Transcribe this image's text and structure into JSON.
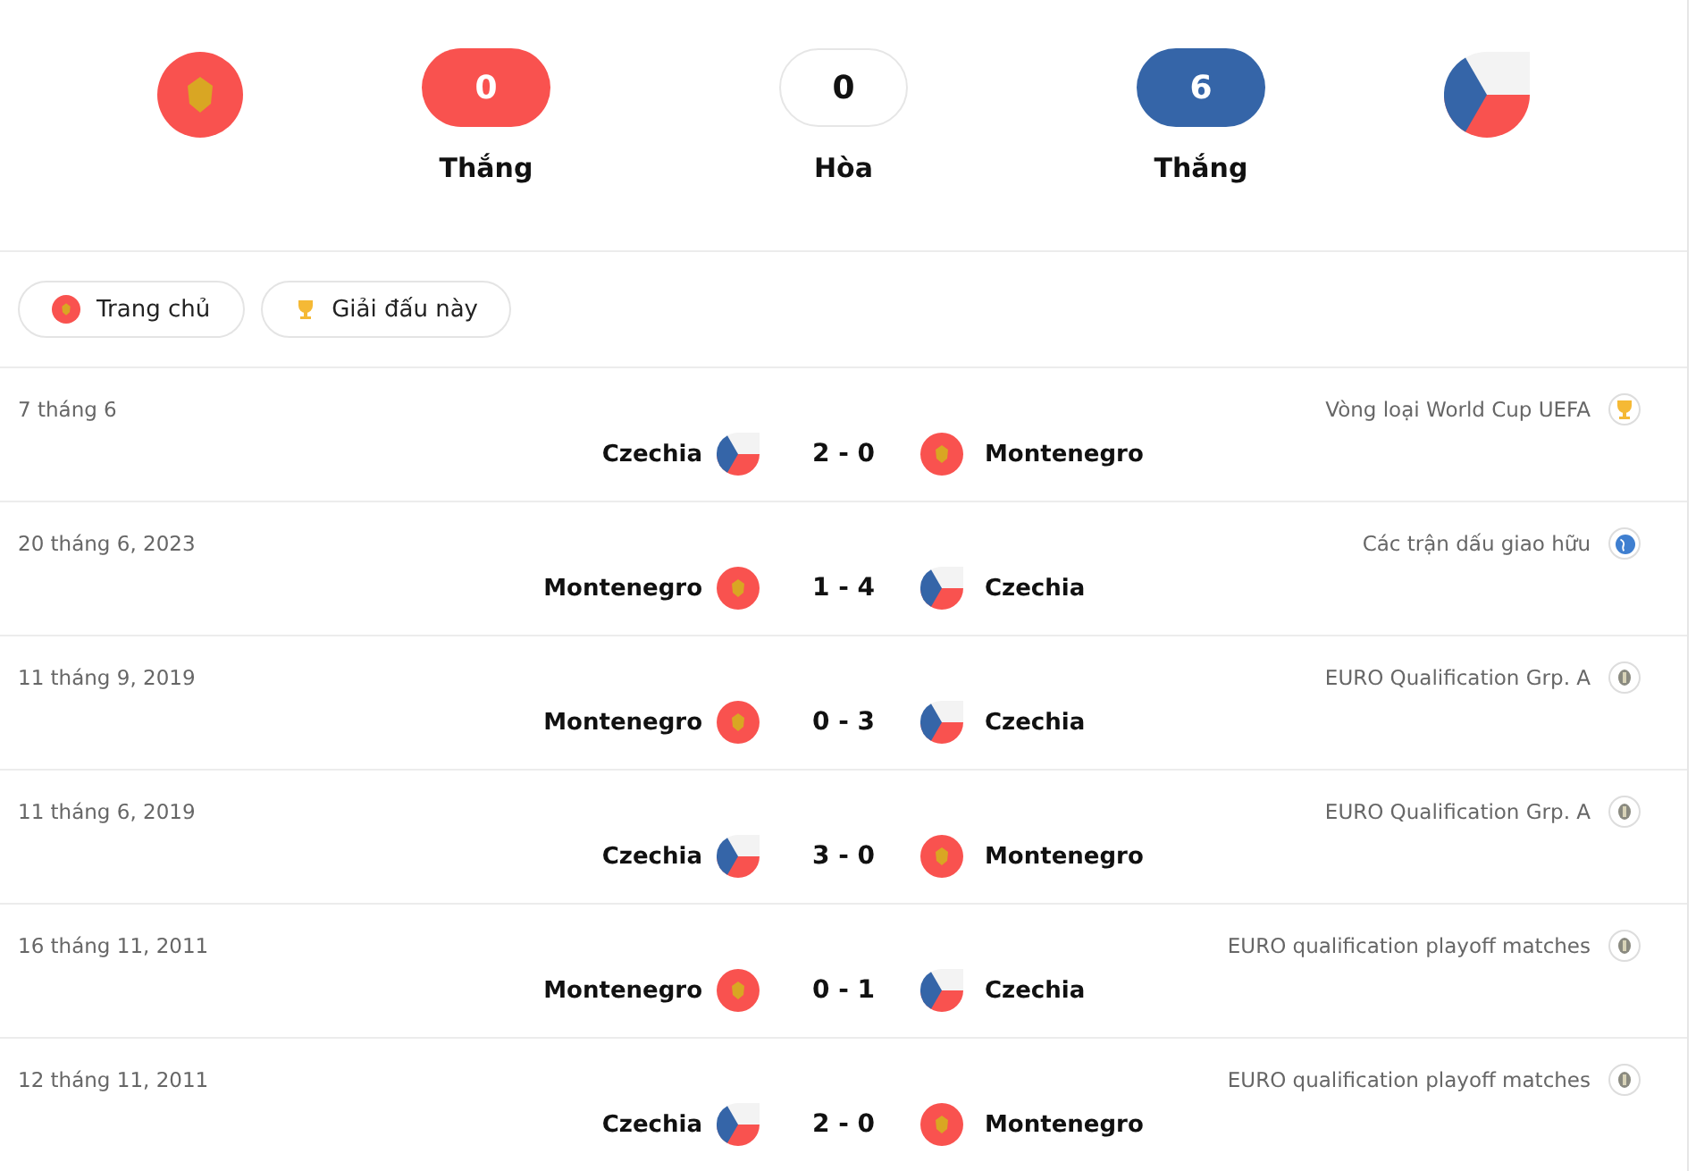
{
  "summary": {
    "home_team": {
      "kind": "me"
    },
    "away_team": {
      "kind": "cz"
    },
    "home": {
      "count": "0",
      "label": "Thắng"
    },
    "draw": {
      "count": "0",
      "label": "Hòa"
    },
    "away": {
      "count": "6",
      "label": "Thắng"
    }
  },
  "filters": [
    {
      "label": "Trang chủ",
      "kind": "me"
    },
    {
      "label": "Giải đấu này",
      "kind": "trophy"
    }
  ],
  "matches": [
    {
      "date": "7 tháng 6",
      "competition": {
        "name": "Vòng loại World Cup UEFA",
        "kind": "trophy"
      },
      "home": {
        "name": "Czechia",
        "kind": "cz"
      },
      "score": "2 - 0",
      "away": {
        "name": "Montenegro",
        "kind": "me"
      }
    },
    {
      "date": "20 tháng 6, 2023",
      "competition": {
        "name": "Các trận dấu giao hữu",
        "kind": "globe"
      },
      "home": {
        "name": "Montenegro",
        "kind": "me"
      },
      "score": "1 - 4",
      "away": {
        "name": "Czechia",
        "kind": "cz"
      }
    },
    {
      "date": "11 tháng 9, 2019",
      "competition": {
        "name": "EURO Qualification Grp. A",
        "kind": "euro"
      },
      "home": {
        "name": "Montenegro",
        "kind": "me"
      },
      "score": "0 - 3",
      "away": {
        "name": "Czechia",
        "kind": "cz"
      }
    },
    {
      "date": "11 tháng 6, 2019",
      "competition": {
        "name": "EURO Qualification Grp. A",
        "kind": "euro"
      },
      "home": {
        "name": "Czechia",
        "kind": "cz"
      },
      "score": "3 - 0",
      "away": {
        "name": "Montenegro",
        "kind": "me"
      }
    },
    {
      "date": "16 tháng 11, 2011",
      "competition": {
        "name": "EURO qualification playoff matches",
        "kind": "euro"
      },
      "home": {
        "name": "Montenegro",
        "kind": "me"
      },
      "score": "0 - 1",
      "away": {
        "name": "Czechia",
        "kind": "cz"
      }
    },
    {
      "date": "12 tháng 11, 2011",
      "competition": {
        "name": "EURO qualification playoff matches",
        "kind": "euro"
      },
      "home": {
        "name": "Czechia",
        "kind": "cz"
      },
      "score": "2 - 0",
      "away": {
        "name": "Montenegro",
        "kind": "me"
      }
    }
  ]
}
